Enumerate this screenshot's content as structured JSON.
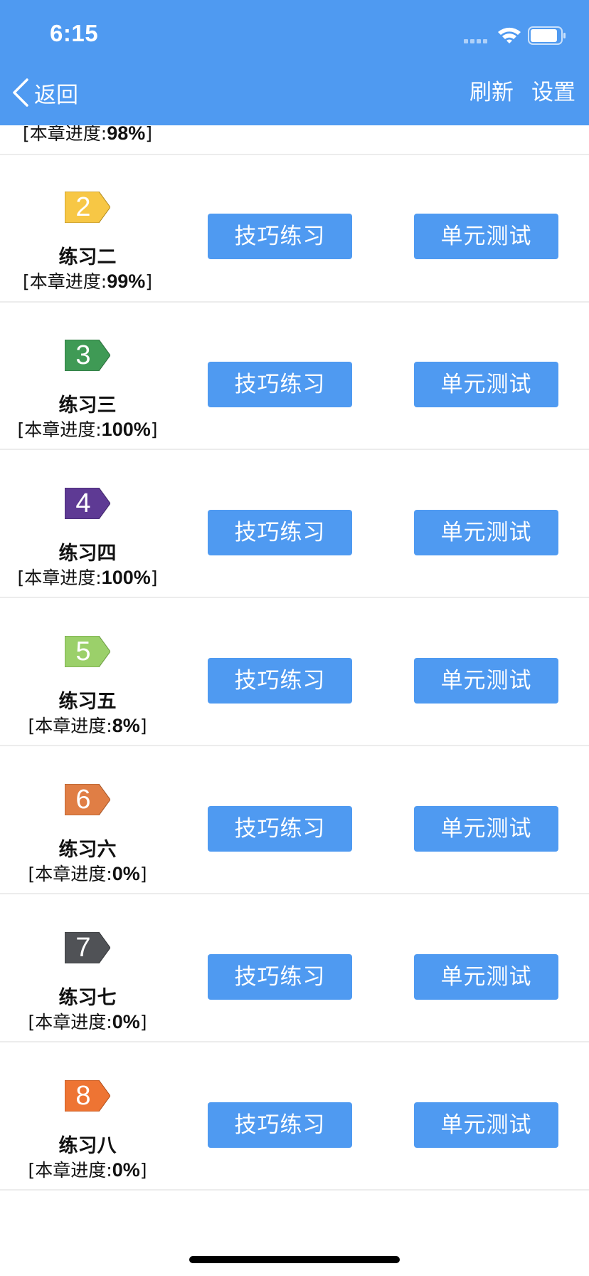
{
  "status_bar": {
    "time": "6:15"
  },
  "nav": {
    "back_label": "返回",
    "refresh_label": "刷新",
    "settings_label": "设置"
  },
  "progress_prefix": "[本章进度:",
  "progress_suffix": "]",
  "buttons": {
    "practice_label": "技巧练习",
    "test_label": "单元测试"
  },
  "partial_row": {
    "progress": "98%"
  },
  "exercises": [
    {
      "number": "2",
      "title": "练习二",
      "progress": "99%",
      "color": "#f7c745"
    },
    {
      "number": "3",
      "title": "练习三",
      "progress": "100%",
      "color": "#3f9a55"
    },
    {
      "number": "4",
      "title": "练习四",
      "progress": "100%",
      "color": "#5e3a94"
    },
    {
      "number": "5",
      "title": "练习五",
      "progress": "8%",
      "color": "#9bd06a"
    },
    {
      "number": "6",
      "title": "练习六",
      "progress": "0%",
      "color": "#e07e45"
    },
    {
      "number": "7",
      "title": "练习七",
      "progress": "0%",
      "color": "#505256"
    },
    {
      "number": "8",
      "title": "练习八",
      "progress": "0%",
      "color": "#ee7433"
    }
  ],
  "colors": {
    "header": "#4f9af1",
    "button": "#4f9af1"
  }
}
